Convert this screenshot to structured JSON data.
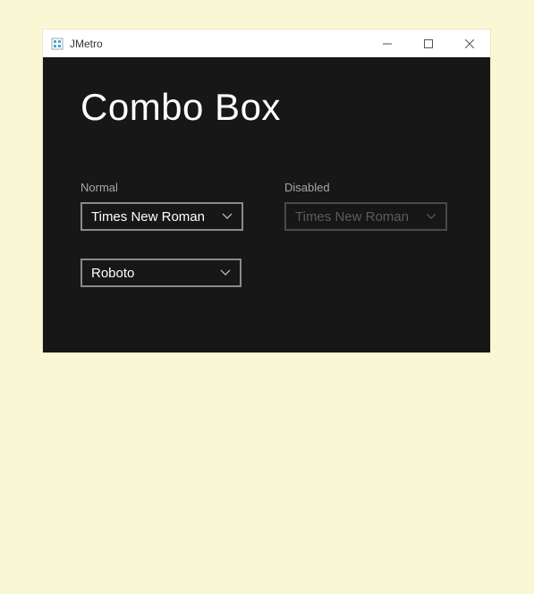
{
  "window": {
    "title": "JMetro"
  },
  "page": {
    "heading": "Combo Box"
  },
  "sections": {
    "normal": {
      "label": "Normal",
      "combo1": {
        "value": "Times New Roman"
      },
      "combo2": {
        "value": "Roboto"
      }
    },
    "disabled": {
      "label": "Disabled",
      "combo1": {
        "value": "Times New Roman"
      }
    }
  }
}
